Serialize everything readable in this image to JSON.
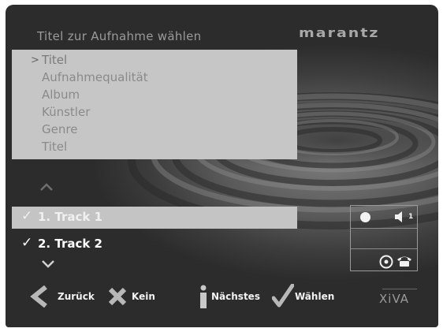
{
  "header": {
    "title": "Titel zur Aufnahme wählen",
    "brand": "marantz"
  },
  "menu": {
    "cursor": ">",
    "items": [
      {
        "label": "Titel",
        "selected": true
      },
      {
        "label": "Aufnahmequalität",
        "selected": false
      },
      {
        "label": "Album",
        "selected": false
      },
      {
        "label": "Künstler",
        "selected": false
      },
      {
        "label": "Genre",
        "selected": false
      },
      {
        "label": "Titel",
        "selected": false
      }
    ]
  },
  "tracks": [
    {
      "check": "✓",
      "label": "1. Track 1",
      "highlighted": true
    },
    {
      "check": "✓",
      "label": "2. Track 2",
      "highlighted": false
    }
  ],
  "status": {
    "speaker_number": "1"
  },
  "buttons": {
    "back": "Zurück",
    "none": "Kein",
    "next": "Nächstes",
    "select": "Wählen"
  },
  "logo_text": "XiVA",
  "colors": {
    "menu_bg": "#c6c6c6",
    "highlight_bg": "#c4c4c4",
    "button_icon": "#b8b8b8"
  }
}
